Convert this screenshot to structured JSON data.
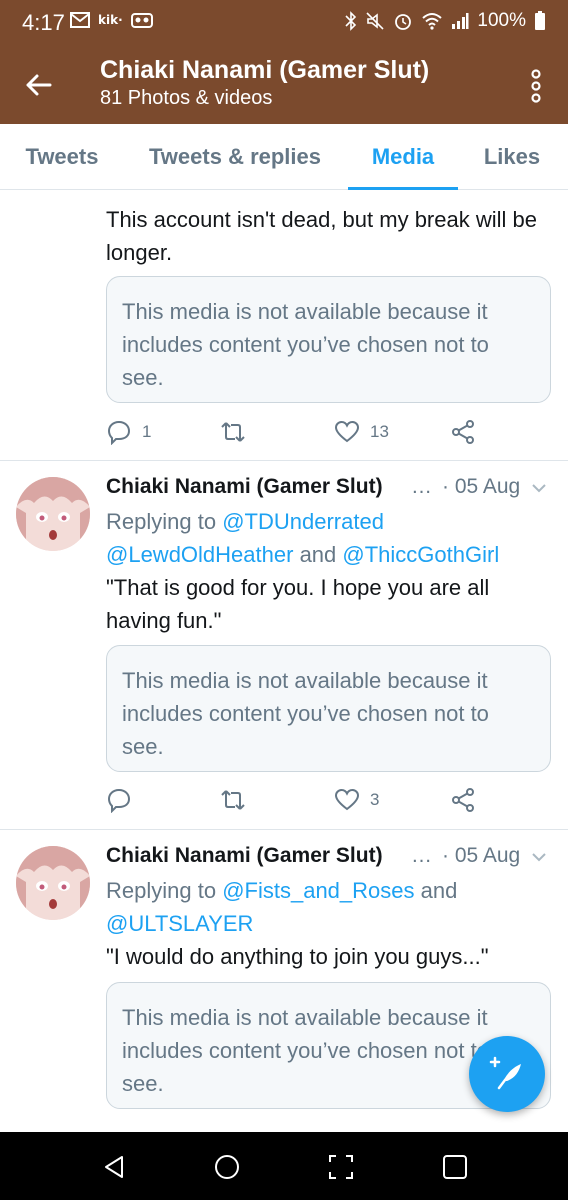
{
  "status_bar": {
    "time": "4:17",
    "kik_label": "kik·",
    "battery": "100%"
  },
  "header": {
    "title": "Chiaki Nanami (Gamer Slut)",
    "subtitle": "81 Photos & videos"
  },
  "tabs": [
    {
      "label": "Tweets",
      "active": false
    },
    {
      "label": "Tweets & replies",
      "active": false
    },
    {
      "label": "Media",
      "active": true
    },
    {
      "label": "Likes",
      "active": false
    }
  ],
  "tweets": [
    {
      "text": "This account isn't dead, but my break will be longer.",
      "media_notice": "This media is not available because it includes content you’ve chosen not to see.",
      "replies": "1",
      "retweets": "",
      "likes": "13"
    },
    {
      "name": "Chiaki Nanami (Gamer Slut)",
      "ellipsis": "…",
      "date": "· 05 Aug",
      "reply_prefix": "Replying to",
      "mention_1": "@TDUnderrated",
      "mention_2": "@LewdOldHeather",
      "and_1": "and",
      "mention_3": "@ThiccGothGirl",
      "text": "\"That is good for you. I hope you are all having fun.\"",
      "media_notice": "This media is not available because it includes content you’ve chosen not to see.",
      "replies": "",
      "retweets": "",
      "likes": "3"
    },
    {
      "name": "Chiaki Nanami (Gamer Slut)",
      "ellipsis": "…",
      "date": "· 05 Aug",
      "reply_prefix": "Replying to",
      "mention_1": "@Fists_and_Roses",
      "and_1": "and",
      "mention_2": "@ULTSLAYER",
      "text": "\"I would do anything to join you guys...\"",
      "media_notice": "This media is not available because it includes content you’ve chosen not to see."
    }
  ],
  "colors": {
    "header_bg": "#7b4a2d",
    "accent": "#1da1f2",
    "muted": "#657786",
    "media_bg": "#f5f8fa"
  }
}
